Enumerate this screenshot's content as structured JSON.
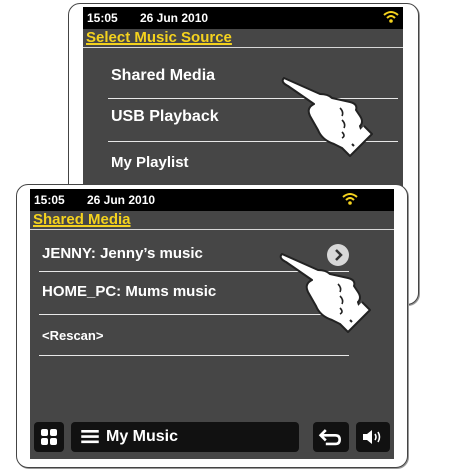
{
  "back_screen": {
    "status": {
      "time": "15:05",
      "date": "26 Jun 2010"
    },
    "title": "Select Music Source",
    "items": [
      {
        "label": "Shared Media"
      },
      {
        "label": "USB Playback"
      },
      {
        "label": "My Playlist"
      }
    ]
  },
  "front_screen": {
    "status": {
      "time": "15:05",
      "date": "26 Jun 2010"
    },
    "title": "Shared Media",
    "items": [
      {
        "label": "JENNY: Jenny’s music"
      },
      {
        "label": "HOME_PC: Mums music"
      },
      {
        "label": "<Rescan>"
      }
    ],
    "bottom_bar": {
      "menu_label": "My Music"
    }
  },
  "colors": {
    "title": "#f4d21e",
    "screen_bg": "#464646",
    "status_bg": "#000000",
    "wifi": "#f4d21e"
  },
  "icons": [
    "wifi-icon",
    "grid-icon",
    "list-icon",
    "back-icon",
    "speaker-icon",
    "chevron-right-icon",
    "pointing-hand-icon"
  ]
}
